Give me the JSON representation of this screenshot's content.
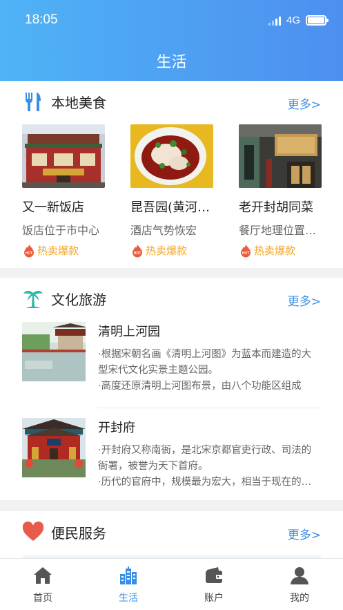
{
  "status": {
    "time": "18:05",
    "network": "4G"
  },
  "header": {
    "title": "生活"
  },
  "food": {
    "title": "本地美食",
    "more": "更多>",
    "items": [
      {
        "name": "又一新饭店",
        "desc": "饭店位于市中心",
        "tag": "热卖爆款",
        "badge": "HOT"
      },
      {
        "name": "昆吾园(黄河路店)",
        "desc": "酒店气势恢宏",
        "tag": "热卖爆款",
        "badge": "HOT"
      },
      {
        "name": "老开封胡同菜",
        "desc": "餐厅地理位置优越",
        "tag": "热卖爆款",
        "badge": "HOT"
      }
    ]
  },
  "tourism": {
    "title": "文化旅游",
    "more": "更多>",
    "items": [
      {
        "name": "清明上河园",
        "line1": "·根据宋朝名画《清明上河图》为蓝本而建造的大型宋代文化实景主题公园。",
        "line2": "·高度还原清明上河图布景，由八个功能区组成"
      },
      {
        "name": "开封府",
        "line1": "·开封府又称南衙，是北宋京都官吏行政、司法的衙署，被誉为天下首府。",
        "line2": "·历代的官府中，规模最为宏大，相当于现在的市政府"
      }
    ]
  },
  "service": {
    "title": "便民服务",
    "more": "更多>"
  },
  "tabs": [
    {
      "label": "首页",
      "icon": "home-icon"
    },
    {
      "label": "生活",
      "icon": "city-icon",
      "active": true
    },
    {
      "label": "账户",
      "icon": "wallet-icon"
    },
    {
      "label": "我的",
      "icon": "user-icon"
    }
  ],
  "colors": {
    "header_start": "#4fb3f6",
    "header_end": "#4d8ff0",
    "accent": "#3a8ee6",
    "hot": "#f5a623"
  }
}
